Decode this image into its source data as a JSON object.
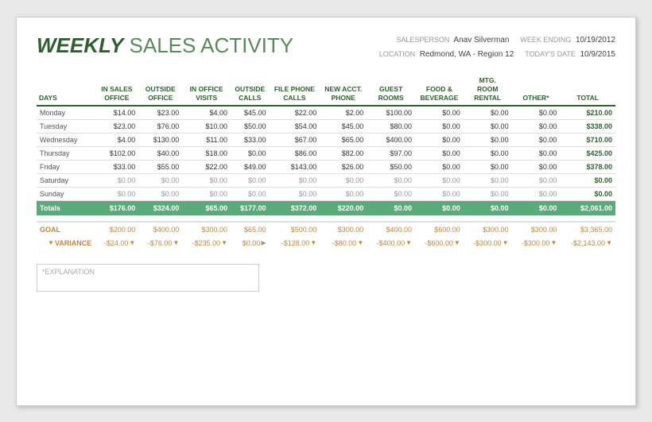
{
  "title": {
    "bold": "WEEKLY",
    "normal": " SALES ACTIVITY"
  },
  "meta": {
    "salesperson_label": "SALESPERSON",
    "salesperson_value": "Anav Silverman",
    "week_ending_label": "WEEK ENDING",
    "week_ending_value": "10/19/2012",
    "location_label": "LOCATION",
    "location_value": "Redmond, WA - Region 12",
    "todays_date_label": "TODAY'S DATE",
    "todays_date_value": "10/9/2015"
  },
  "columns": [
    "DAYS",
    "IN SALES OFFICE",
    "OUTSIDE OFFICE",
    "IN OFFICE VISITS",
    "OUTSIDE CALLS",
    "FILE PHONE CALLS",
    "NEW ACCT. PHONE",
    "GUEST ROOMS",
    "FOOD & BEVERAGE",
    "MTG. ROOM RENTAL",
    "OTHER*",
    "TOTAL"
  ],
  "rows": [
    {
      "day": "Monday",
      "vals": [
        "$14.00",
        "$23.00",
        "$4.00",
        "$45.00",
        "$22.00",
        "$2.00",
        "$100.00",
        "$0.00",
        "$0.00",
        "$0.00",
        "$210.00"
      ]
    },
    {
      "day": "Tuesday",
      "vals": [
        "$23.00",
        "$76.00",
        "$10.00",
        "$50.00",
        "$54.00",
        "$45.00",
        "$80.00",
        "$0.00",
        "$0.00",
        "$0.00",
        "$338.00"
      ]
    },
    {
      "day": "Wednesday",
      "vals": [
        "$4.00",
        "$130.00",
        "$11.00",
        "$33.00",
        "$67.00",
        "$65.00",
        "$400.00",
        "$0.00",
        "$0.00",
        "$0.00",
        "$710.00"
      ]
    },
    {
      "day": "Thursday",
      "vals": [
        "$102.00",
        "$40.00",
        "$18.00",
        "$0.00",
        "$86.00",
        "$82.00",
        "$97.00",
        "$0.00",
        "$0.00",
        "$0.00",
        "$425.00"
      ]
    },
    {
      "day": "Friday",
      "vals": [
        "$33.00",
        "$55.00",
        "$22.00",
        "$49.00",
        "$143.00",
        "$26.00",
        "$50.00",
        "$0.00",
        "$0.00",
        "$0.00",
        "$378.00"
      ]
    },
    {
      "day": "Saturday",
      "vals": [
        "$0.00",
        "$0.00",
        "$0.00",
        "$0.00",
        "$0.00",
        "$0.00",
        "$0.00",
        "$0.00",
        "$0.00",
        "$0.00",
        "$0.00"
      ],
      "zero": true
    },
    {
      "day": "Sunday",
      "vals": [
        "$0.00",
        "$0.00",
        "$0.00",
        "$0.00",
        "$0.00",
        "$0.00",
        "$0.00",
        "$0.00",
        "$0.00",
        "$0.00",
        "$0.00"
      ],
      "zero": true
    }
  ],
  "totals": {
    "label": "Totals",
    "vals": [
      "$176.00",
      "$324.00",
      "$65.00",
      "$177.00",
      "$372.00",
      "$220.00",
      "$0.00",
      "$0.00",
      "$0.00",
      "$0.00",
      "$2,061.00"
    ]
  },
  "goal": {
    "label": "GOAL",
    "vals": [
      "$200.00",
      "$400.00",
      "$300.00",
      "$65.00",
      "$500.00",
      "$300.00",
      "$400.00",
      "$600.00",
      "$300.00",
      "$300.00",
      "$3,365.00"
    ]
  },
  "variance": {
    "label": "VARIANCE",
    "vals": [
      "-$24.00",
      "-$76.00",
      "-$235.00",
      "$0.00",
      "-$128.00",
      "-$80.00",
      "-$400.00",
      "-$600.00",
      "-$300.00",
      "-$300.00",
      "-$2,143.00"
    ],
    "directions": [
      "down",
      "down",
      "down",
      "flat",
      "down",
      "down",
      "down",
      "down",
      "down",
      "down",
      "down"
    ]
  },
  "explanation_placeholder": "*EXPLANATION"
}
